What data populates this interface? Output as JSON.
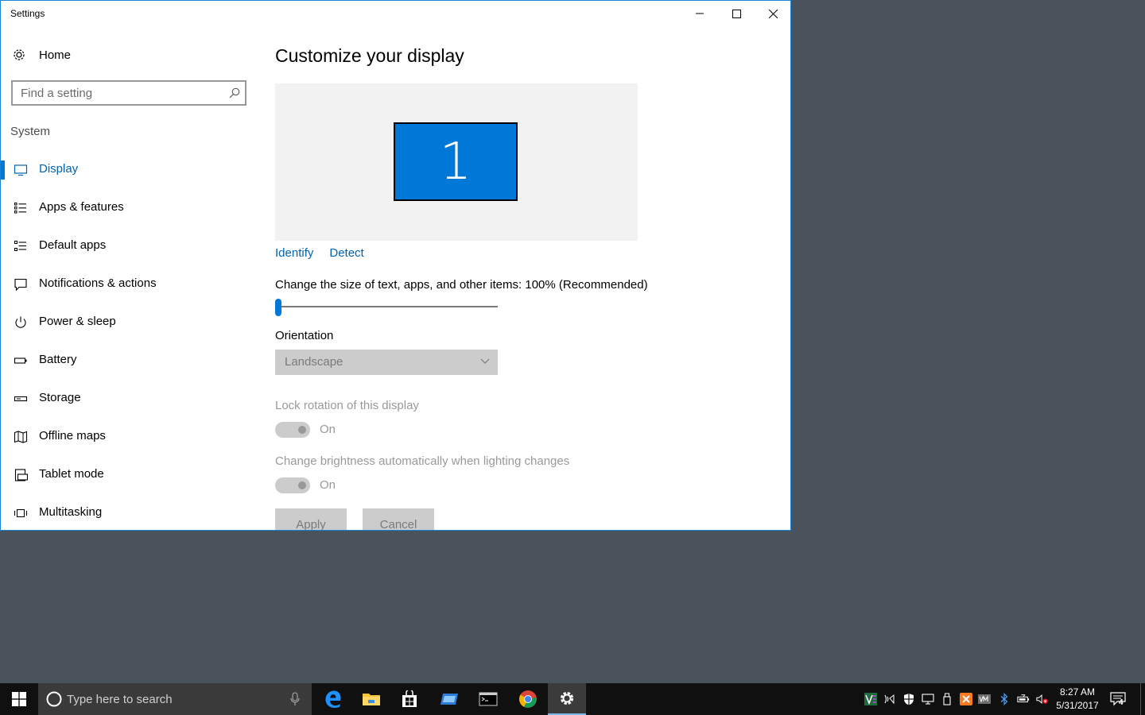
{
  "window": {
    "title": "Settings",
    "accent": "#0078d7"
  },
  "sidebar": {
    "home_label": "Home",
    "search_placeholder": "Find a setting",
    "section": "System",
    "items": [
      {
        "label": "Display",
        "icon": "monitor-icon",
        "active": true
      },
      {
        "label": "Apps & features",
        "icon": "apps-list-icon"
      },
      {
        "label": "Default apps",
        "icon": "default-apps-icon"
      },
      {
        "label": "Notifications & actions",
        "icon": "notification-icon"
      },
      {
        "label": "Power & sleep",
        "icon": "power-icon"
      },
      {
        "label": "Battery",
        "icon": "battery-icon"
      },
      {
        "label": "Storage",
        "icon": "storage-icon"
      },
      {
        "label": "Offline maps",
        "icon": "map-icon"
      },
      {
        "label": "Tablet mode",
        "icon": "tablet-mode-icon"
      },
      {
        "label": "Multitasking",
        "icon": "multitasking-icon"
      }
    ]
  },
  "main": {
    "title": "Customize your display",
    "monitor_number": "1",
    "identify_link": "Identify",
    "detect_link": "Detect",
    "scale_label": "Change the size of text, apps, and other items: 100% (Recommended)",
    "scale_slider_value": 0,
    "orientation_label": "Orientation",
    "orientation_value": "Landscape",
    "lock_rotation_label": "Lock rotation of this display",
    "lock_rotation_state": "On",
    "brightness_label": "Change brightness automatically when lighting changes",
    "brightness_state": "On",
    "apply_label": "Apply",
    "cancel_label": "Cancel"
  },
  "taskbar": {
    "search_placeholder": "Type here to search",
    "apps": [
      "edge-icon",
      "file-explorer-icon",
      "store-icon",
      "remote-desktop-icon",
      "terminal-icon",
      "chrome-icon",
      "settings-gear-icon"
    ],
    "time": "8:27 AM",
    "date": "5/31/2017",
    "notification_count": "4"
  }
}
